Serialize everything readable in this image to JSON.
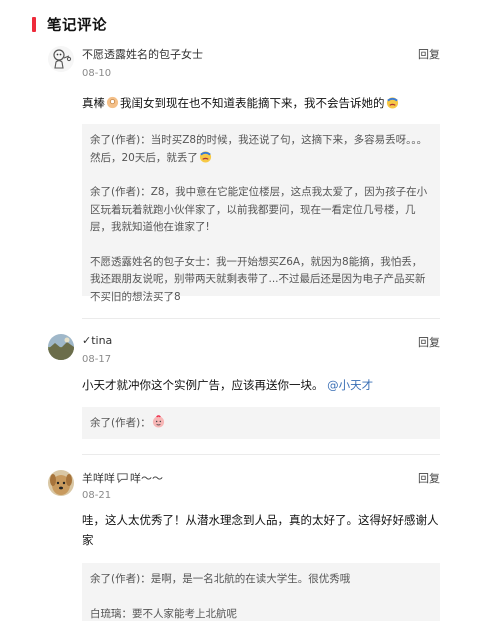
{
  "section": {
    "title": "笔记评论"
  },
  "reply_label": "回复",
  "comments": [
    {
      "user": "不愿透露姓名的包子女士",
      "date": "08-10",
      "text_a": "真棒",
      "text_b": "我闺女到现在也不知道表能摘下来，我不会告诉她的",
      "replies": [
        {
          "a": "余了(作者)：当时买Z8的时候，我还说了句，这摘下来，多容易丢呀。。。然后，20天后，就丢了",
          "b": ""
        },
        {
          "a": "余了(作者)：Z8，我中意在它能定位楼层，这点我太爱了，因为孩子在小区玩着玩着就跑小伙伴家了，以前我都要问，现在一看定位几号楼，几层，我就知道他在谁家了!",
          "b": ""
        },
        {
          "a": "不愿透露姓名的包子女士：我一开始想买Z6A，就因为8能摘，我怕丢，我还跟朋友说呢，别带两天就剩表带了...不过最后还是因为电子产品买新不买旧的想法买了8",
          "b": ""
        }
      ]
    },
    {
      "user": "✓tina",
      "date": "08-17",
      "text": "小天才就冲你这个实例广告，应该再送你一块。",
      "mention": "@小天才",
      "reply": "余了(作者)："
    },
    {
      "user_a": "羊咩咩",
      "user_b": "咩～～",
      "date": "08-21",
      "text": "哇，这人太优秀了！从潜水理念到人品，真的太好了。这得好好感谢人家",
      "replies": [
        "余了(作者)：是啊，是一名北航的在读大学生。很优秀哦",
        "白琉璃：要不人家能考上北航呢"
      ]
    }
  ],
  "icons": {
    "c1_avatar": "cartoon-avatar-icon",
    "c2_avatar": "landscape-avatar-icon",
    "c3_avatar": "dog-avatar-icon",
    "emoji_thumb": "ok-hand-emoji-icon",
    "emoji_sweat": "sweat-smile-emoji-icon",
    "emoji_heart": "pink-heart-face-emoji-icon",
    "emoji_chat": "speech-bubble-emoji-icon"
  }
}
